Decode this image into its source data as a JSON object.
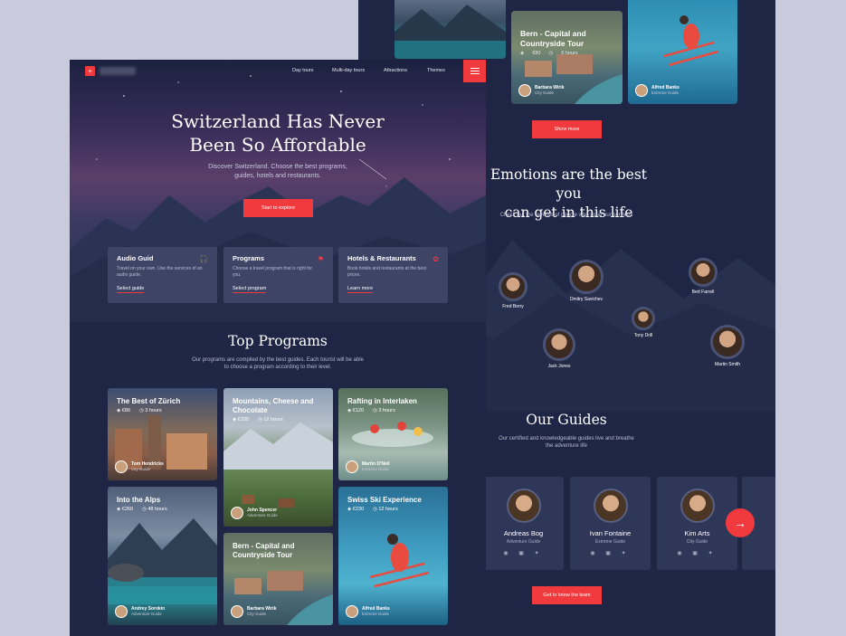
{
  "colors": {
    "accent": "#f13a3e",
    "panel": "#1f2645",
    "card": "#2f3759",
    "bg": "#c9cbdc"
  },
  "nav": {
    "logo_glyph": "+",
    "links": [
      "Day tours",
      "Multi-day tours",
      "Attractions",
      "Themes"
    ],
    "menu_icon": "hamburger-icon"
  },
  "hero": {
    "title_line1": "Switzerland Has Never",
    "title_line2": "Been So Affordable",
    "subtitle": "Discover Switzerland. Choose the best programs, guides, hotels and restaurants.",
    "cta": "Start to explore"
  },
  "features": [
    {
      "title": "Audio Guid",
      "icon": "headphones-icon",
      "desc": "Travel on your own. Use the services of an audio guide.",
      "link": "Select guide"
    },
    {
      "title": "Programs",
      "icon": "signpost-icon",
      "desc": "Choose a travel program that is right for you.",
      "link": "Select program"
    },
    {
      "title": "Hotels & Restaurants",
      "icon": "hotel-icon",
      "desc": "Book hotels and restaurants at the best prices.",
      "link": "Learn more"
    }
  ],
  "top_programs": {
    "title": "Top Programs",
    "subtitle": "Our programs are compiled by the best guides. Each tourist will be able to choose a program according to their level.",
    "cards": [
      {
        "title": "The Best of Zürich",
        "price": "€80",
        "duration": "3 hours",
        "guide": "Tom Hendricks",
        "role": "City Guide"
      },
      {
        "title": "Mountains, Cheese and Chocolate",
        "price": "€200",
        "duration": "12 hours",
        "guide": "John Spencer",
        "role": "Adventure Guide"
      },
      {
        "title": "Rafting in Interlaken",
        "price": "€120",
        "duration": "3 hours",
        "guide": "Martin O'Neil",
        "role": "Extreme Guide"
      },
      {
        "title": "Into the Alps",
        "price": "€260",
        "duration": "48 hours",
        "guide": "Andrey Sorokin",
        "role": "Adventure Guide"
      },
      {
        "title": "Bern - Capital and Countryside Tour",
        "price": "",
        "duration": "",
        "guide": "Barbara Wirik",
        "role": "City Guide"
      },
      {
        "title": "Swiss Ski Experience",
        "price": "€230",
        "duration": "12 hours",
        "guide": "Alfred Banks",
        "role": "Extreme Guide"
      }
    ]
  },
  "back": {
    "bern_card": {
      "title": "Bern - Capital and Countryside Tour",
      "price": "€80",
      "duration": "6 hours",
      "guide": "Barbara Wirik",
      "role": "City Guide"
    },
    "ski_card": {
      "guide": "Alfred Banks",
      "role": "Extreme Guide"
    },
    "show_more": "Show more",
    "emotions_title_line1": "Emotions are the best you",
    "emotions_title_line2": "can get in this life",
    "emotions_sub": "Check out the reviews of people who used our services",
    "people": [
      "Fred Berry",
      "Dmitry Savichev",
      "Bert Farrell",
      "Tony Drill",
      "Jack Jones",
      "Martin Smith"
    ],
    "guides_title": "Our Guides",
    "guides_sub": "Our certified and knowledgeable guides live and breathe the adventure life",
    "guides": [
      {
        "name": "Andreas Bog",
        "role": "Adventure Guide"
      },
      {
        "name": "Ivan Fontaine",
        "role": "Extreme Guide"
      },
      {
        "name": "Kim Arts",
        "role": "City Guide"
      }
    ],
    "social_icons": "◉ ▣ ✦",
    "next_arrow": "→",
    "team_button": "Get to know the team"
  }
}
